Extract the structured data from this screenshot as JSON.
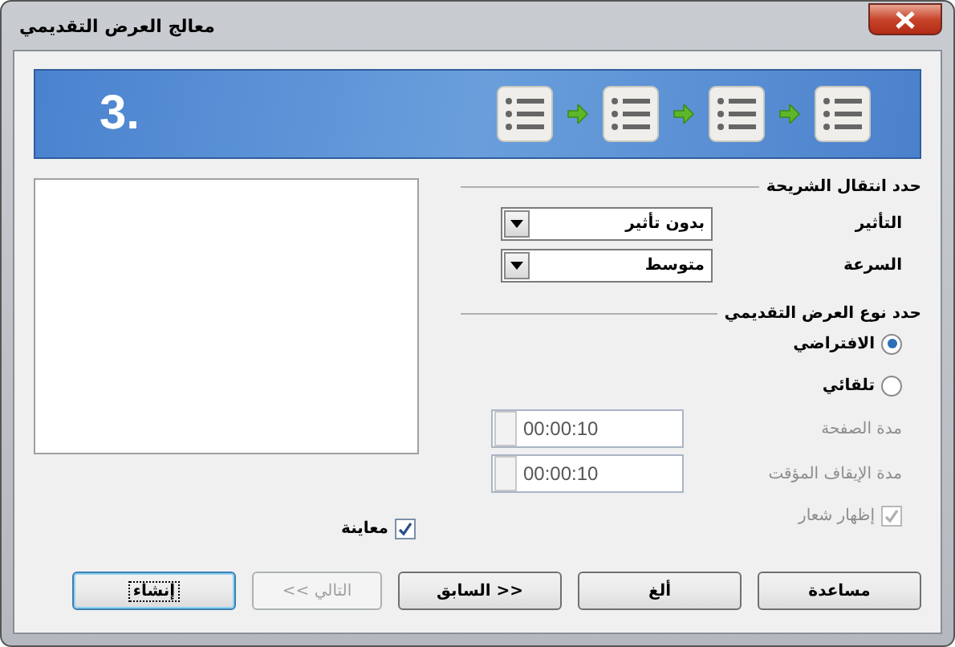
{
  "window": {
    "title": "معالج العرض التقديمي"
  },
  "banner": {
    "step": "3."
  },
  "transition": {
    "heading": "حدد انتقال الشريحة",
    "effect": {
      "label": "التأثير",
      "value": "بدون تأثير"
    },
    "speed": {
      "label": "السرعة",
      "value": "متوسط"
    }
  },
  "presentation_type": {
    "heading": "حدد نوع العرض التقديمي",
    "options": [
      {
        "label": "الافتراضي",
        "selected": true
      },
      {
        "label": "تلقائي",
        "selected": false
      }
    ],
    "page_duration": {
      "label": "مدة الصفحة",
      "value": "00:00:10",
      "disabled": true
    },
    "pause_duration": {
      "label": "مدة الإيقاف المؤقت",
      "value": "00:00:10",
      "disabled": true
    },
    "show_logo": {
      "label": "إظهار شعار",
      "checked": true,
      "disabled": true
    }
  },
  "preview": {
    "label": "معاينة",
    "checked": true
  },
  "buttons": [
    {
      "label": "مساعدة",
      "disabled": false,
      "default": false
    },
    {
      "label": "ألغ",
      "disabled": false,
      "default": false
    },
    {
      "label": "<< السابق",
      "disabled": false,
      "default": false
    },
    {
      "label": "التالي >>",
      "disabled": true,
      "default": false
    },
    {
      "label": "إنشاء",
      "disabled": false,
      "default": true
    }
  ]
}
